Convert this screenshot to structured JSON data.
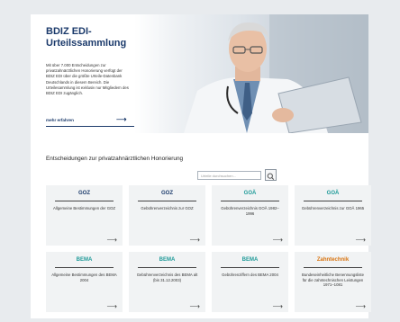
{
  "hero": {
    "title_line1": "BDIZ EDI-",
    "title_line2": "Urteilssammlung",
    "description": "Mit über 7.000 Entscheidungen zur privatzahnärztlichen Honorierung verfügt der BDIZ EDI über die größte Urteile-Datenbank Deutschlands in diesem Bereich. Die Urteilesammlung ist exklusiv nur Mitgliedern des BDIZ EDI zugänglich.",
    "link_label": "mehr erfahren",
    "arrow": "⟶"
  },
  "section": {
    "heading": "Entscheidungen zur privatzahnärztlichen Honorierung",
    "search_placeholder": "Urteile durchsuchen..."
  },
  "colors": {
    "navy": "#1b3a6b",
    "teal": "#1e9a98",
    "orange": "#d8730f"
  },
  "cards": [
    {
      "title": "GOZ",
      "color": "#1b3a6b",
      "subtitle": "Allgemeine Bestimmungen der GOZ",
      "arrow": "⟶"
    },
    {
      "title": "GOZ",
      "color": "#1b3a6b",
      "subtitle": "Gebührenverzeichnis zur GOZ",
      "arrow": "⟶"
    },
    {
      "title": "GOÄ",
      "color": "#1e9a98",
      "subtitle": "Gebührenverzeichnis GOÄ 1982–1996",
      "arrow": "⟶"
    },
    {
      "title": "GOÄ",
      "color": "#1e9a98",
      "subtitle": "Gebührenverzeichnis zur GOÄ 1965",
      "arrow": "⟶"
    },
    {
      "title": "BEMA",
      "color": "#1e9a98",
      "subtitle": "Allgemeine Bestimmungen des BEMA 2004",
      "arrow": "⟶"
    },
    {
      "title": "BEMA",
      "color": "#1e9a98",
      "subtitle": "Gebührenverzeichnis des BEMA alt (bis 31.12.2003)",
      "arrow": "⟶"
    },
    {
      "title": "BEMA",
      "color": "#1e9a98",
      "subtitle": "Gebührenziffern des BEMA 2004",
      "arrow": "⟶"
    },
    {
      "title": "Zahntechnik",
      "color": "#d8730f",
      "subtitle": "Bundeseinheitliche Benennungsliste für die zahntechnischen Leistungen 1971–1081",
      "arrow": "⟶"
    }
  ]
}
